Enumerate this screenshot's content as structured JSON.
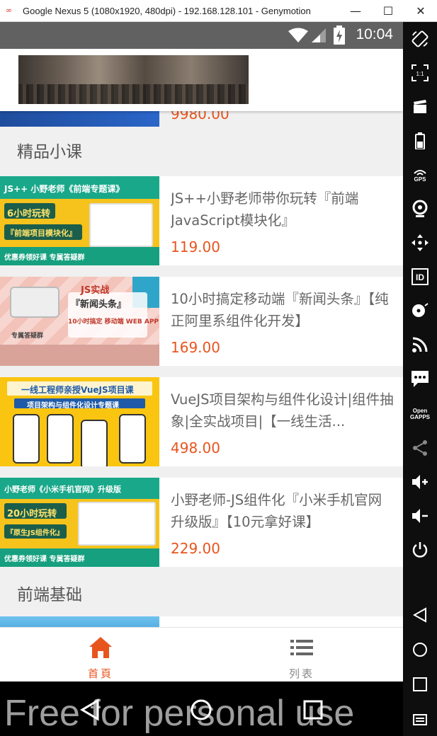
{
  "window": {
    "title": "Google Nexus 5 (1080x1920, 480dpi) - 192.168.128.101 - Genymotion",
    "app_icon": "genymotion-logo-icon",
    "minimize_glyph": "—",
    "maximize_glyph": "☐",
    "close_glyph": "✕"
  },
  "status_bar": {
    "time": "10:04",
    "icons": [
      "wifi-icon",
      "signal-icon",
      "battery-charging-icon"
    ]
  },
  "top_item": {
    "price": "9980.00"
  },
  "sections": [
    {
      "title": "精品小课"
    },
    {
      "title": "前端基础"
    }
  ],
  "courses": [
    {
      "name": "JS++小野老师带你玩转『前端JavaScript模块化』",
      "price": "119.00",
      "thumb": {
        "line1": "JS++ 小野老师《前端专题课》",
        "line2": "6小时玩转",
        "line3": "『前端项目模块化』",
        "line4": "优惠券领好课 专属答疑群"
      }
    },
    {
      "name": "10小时搞定移动端『新闻头条』【纯正阿里系组件化开发】",
      "price": "169.00",
      "thumb": {
        "line1": "JS实战",
        "line2": "『新闻头条』",
        "line3": "10小时搞定 移动端 WEB APP",
        "line4": "专属答疑群"
      }
    },
    {
      "name": "VueJS项目架构与组件化设计|组件抽象|全实战项目|【一线生活...",
      "price": "498.00",
      "thumb": {
        "line1": "一线工程师亲授VueJS项目课",
        "line2": "项目架构与组件化设计专题课"
      }
    },
    {
      "name": "小野老师-JS组件化『小米手机官网升级版』【10元拿好课】",
      "price": "229.00",
      "thumb": {
        "line1": "小野老师《小米手机官网》升级版",
        "line2": "20小时玩转",
        "line3": "『原生JS组件化』",
        "line4": "优惠券领好课 专属答疑群"
      }
    }
  ],
  "tab_bar": {
    "tabs": [
      {
        "label": "首頁",
        "icon": "home-icon",
        "active": true
      },
      {
        "label": "列表",
        "icon": "list-icon",
        "active": false
      }
    ],
    "active_color": "#e8541e",
    "inactive_color": "#888888"
  },
  "nav_bar": {
    "icons": [
      "back-icon",
      "home-circle-icon",
      "recents-icon"
    ]
  },
  "watermark": "Free for personal use",
  "genymotion_sidebar": {
    "gps_label": "GPS",
    "open_gapps_label": "Open GAPPS",
    "id_label": "ID",
    "scale_label": "1:1"
  }
}
